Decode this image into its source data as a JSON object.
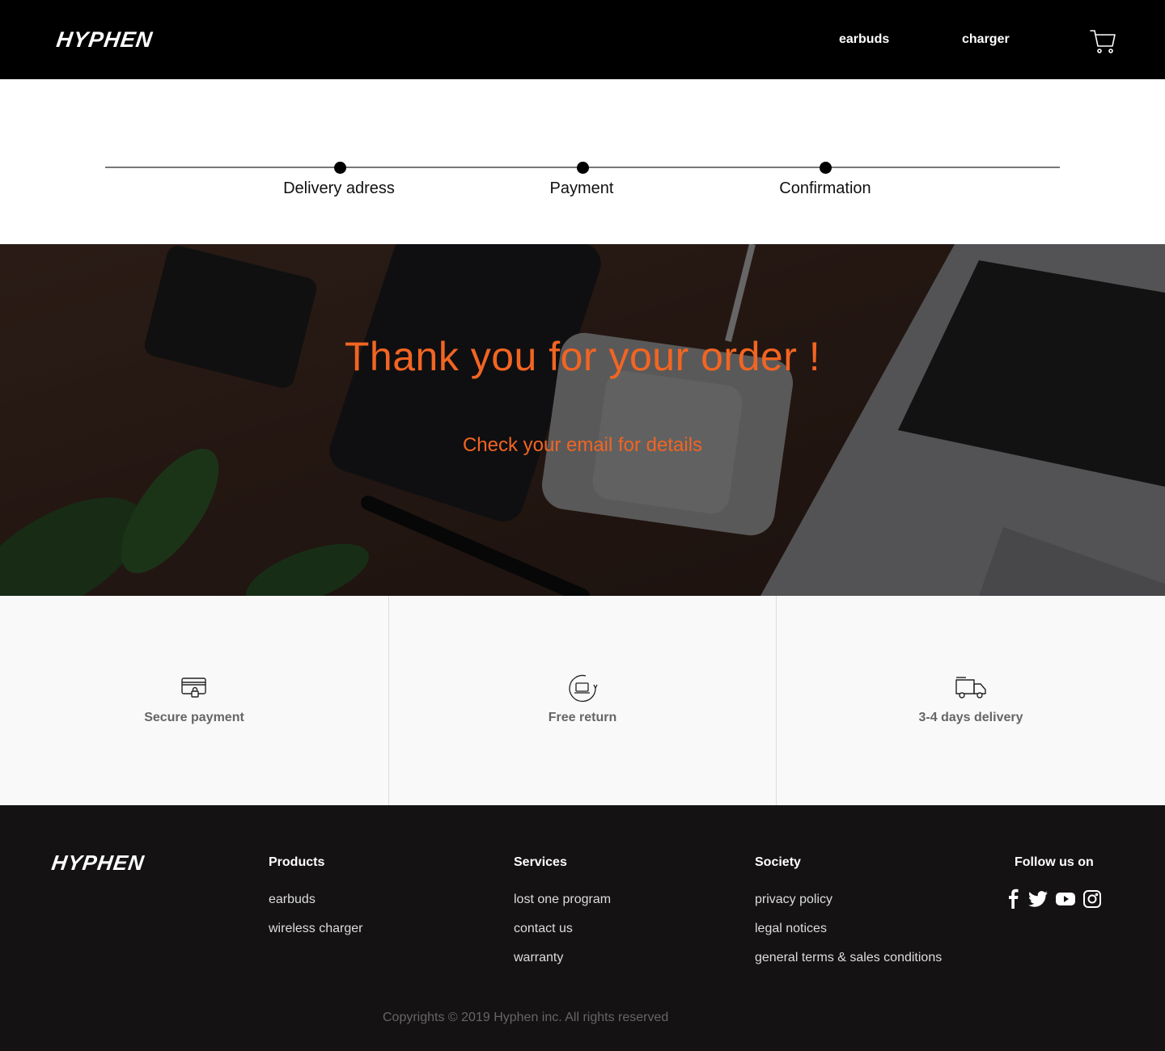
{
  "header": {
    "logo": "HYPHEN",
    "nav": {
      "earbuds": "earbuds",
      "charger": "charger"
    }
  },
  "stepper": {
    "steps": [
      "Delivery adress",
      "Payment",
      "Confirmation"
    ]
  },
  "hero": {
    "title": "Thank you for your order !",
    "subtitle": "Check your email for details",
    "accent_color": "#f26522"
  },
  "features": [
    {
      "label": "Secure payment",
      "icon": "credit-card-lock-icon"
    },
    {
      "label": "Free return",
      "icon": "return-device-icon"
    },
    {
      "label": "3-4 days delivery",
      "icon": "delivery-truck-icon"
    }
  ],
  "footer": {
    "logo": "HYPHEN",
    "products": {
      "heading": "Products",
      "links": [
        "earbuds",
        "wireless charger"
      ]
    },
    "services": {
      "heading": "Services",
      "links": [
        "lost one program",
        "contact us",
        "warranty"
      ]
    },
    "society": {
      "heading": "Society",
      "links": [
        "privacy policy",
        "legal notices",
        "general terms & sales conditions"
      ]
    },
    "follow": {
      "heading": "Follow us on",
      "icons": [
        "facebook-icon",
        "twitter-icon",
        "youtube-icon",
        "instagram-icon"
      ]
    },
    "copyright": "Copyrights © 2019 Hyphen inc. All rights reserved"
  }
}
